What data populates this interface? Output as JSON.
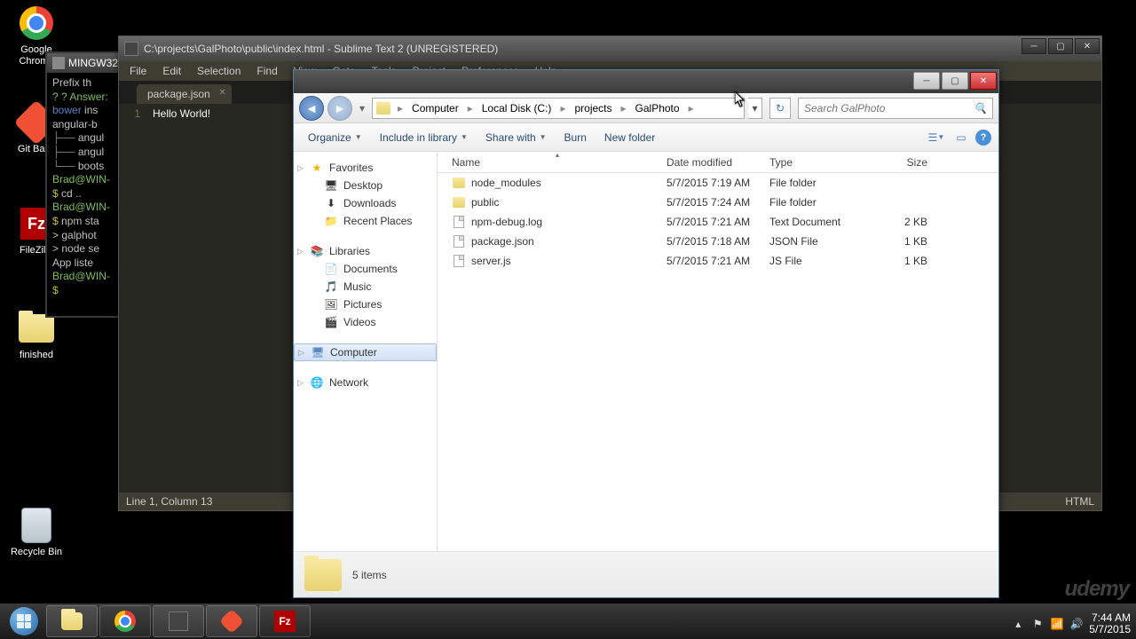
{
  "desktop": {
    "icons": [
      {
        "name": "Google Chrome"
      },
      {
        "name": "Git Bash"
      },
      {
        "name": "FileZilla"
      },
      {
        "name": "finished"
      },
      {
        "name": "Recycle Bin"
      }
    ]
  },
  "terminal": {
    "title": "MINGW32",
    "lines": {
      "l1": "Prefix th",
      "l2": "? Answer:",
      "l3": "bower ins",
      "l4": "angular-b",
      "l5": "angul",
      "l6": "angul",
      "l7": "boots",
      "l8": "Brad@WIN-",
      "l9": "$ cd ..",
      "l10": "Brad@WIN-",
      "l11": "$ npm sta",
      "l12": "galphot",
      "l13": "node se",
      "l14": "App liste",
      "l15": "Brad@WIN-",
      "l16": "$"
    }
  },
  "sublime": {
    "title": "C:\\projects\\GalPhoto\\public\\index.html - Sublime Text 2 (UNREGISTERED)",
    "menu": [
      "File",
      "Edit",
      "Selection",
      "Find",
      "View",
      "Goto",
      "Tools",
      "Project",
      "Preferences",
      "Help"
    ],
    "tab": "package.json",
    "line_no": "1",
    "content": "Hello World!",
    "status_left": "Line 1, Column 13",
    "status_right": "HTML"
  },
  "explorer": {
    "breadcrumb": [
      "Computer",
      "Local Disk (C:)",
      "projects",
      "GalPhoto"
    ],
    "search_placeholder": "Search GalPhoto",
    "toolbar": {
      "organize": "Organize",
      "include": "Include in library",
      "share": "Share with",
      "burn": "Burn",
      "newfolder": "New folder"
    },
    "sidebar": {
      "favorites": {
        "label": "Favorites",
        "items": [
          "Desktop",
          "Downloads",
          "Recent Places"
        ]
      },
      "libraries": {
        "label": "Libraries",
        "items": [
          "Documents",
          "Music",
          "Pictures",
          "Videos"
        ]
      },
      "computer": {
        "label": "Computer"
      },
      "network": {
        "label": "Network"
      }
    },
    "columns": {
      "name": "Name",
      "date": "Date modified",
      "type": "Type",
      "size": "Size"
    },
    "files": [
      {
        "name": "node_modules",
        "date": "5/7/2015 7:19 AM",
        "type": "File folder",
        "size": "",
        "kind": "folder"
      },
      {
        "name": "public",
        "date": "5/7/2015 7:24 AM",
        "type": "File folder",
        "size": "",
        "kind": "folder"
      },
      {
        "name": "npm-debug.log",
        "date": "5/7/2015 7:21 AM",
        "type": "Text Document",
        "size": "2 KB",
        "kind": "file"
      },
      {
        "name": "package.json",
        "date": "5/7/2015 7:18 AM",
        "type": "JSON File",
        "size": "1 KB",
        "kind": "file"
      },
      {
        "name": "server.js",
        "date": "5/7/2015 7:21 AM",
        "type": "JS File",
        "size": "1 KB",
        "kind": "file"
      }
    ],
    "status": "5 items"
  },
  "taskbar": {
    "clock_time": "7:44 AM",
    "clock_date": "5/7/2015"
  },
  "watermark": "udemy"
}
